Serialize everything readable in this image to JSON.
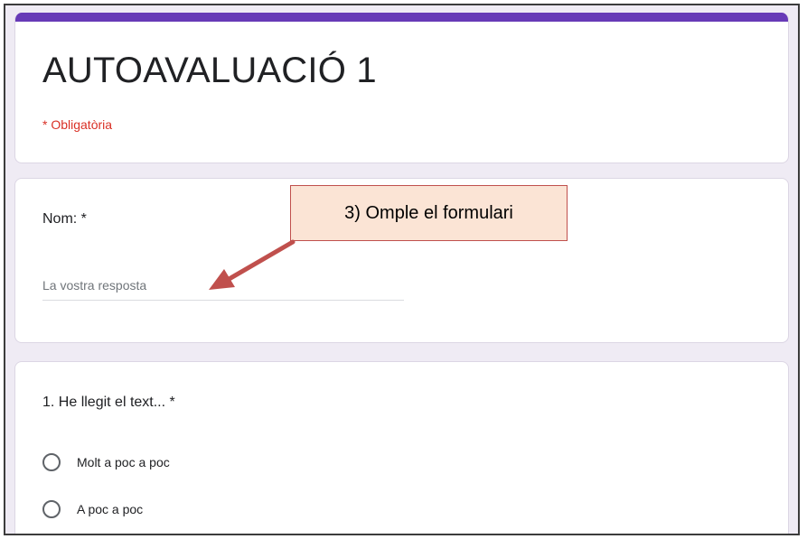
{
  "form": {
    "title": "AUTOAVALUACIÓ 1",
    "required_note": "* Obligatòria",
    "accent_color": "#673ab7"
  },
  "question_name": {
    "label": "Nom: *",
    "placeholder": "La vostra resposta"
  },
  "question_1": {
    "label": "1. He llegit el text... *",
    "options": [
      "Molt a poc a poc",
      "A poc a poc"
    ]
  },
  "annotation": {
    "text": "3) Omple el formulari",
    "arrow_color": "#c0504d"
  }
}
